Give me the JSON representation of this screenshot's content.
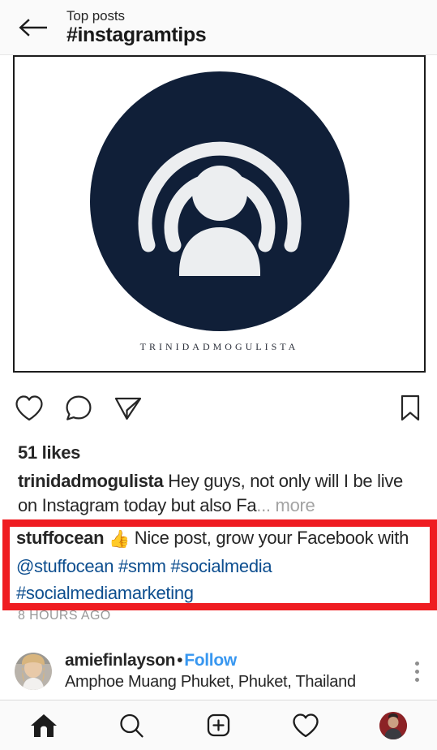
{
  "header": {
    "back_icon": "arrow-left-icon",
    "subtitle": "Top posts",
    "title": "#instagramtips"
  },
  "post": {
    "media": {
      "brand_text": "TRINIDADMOGULISTA",
      "logo_icon": "broadcast-person-icon",
      "logo_bg_color": "#101f38",
      "logo_fg_color": "#eceef0"
    },
    "actions": {
      "like_icon": "heart-icon",
      "comment_icon": "comment-bubble-icon",
      "share_icon": "paper-plane-icon",
      "save_icon": "bookmark-icon"
    },
    "likes": "51 likes",
    "caption": {
      "username": "trinidadmogulista",
      "text": " Hey guys, not only will I be live on Instagram today but also Fa",
      "ellipsis": "...",
      "more_label": " more"
    },
    "highlighted_comment": {
      "username": "stuffocean",
      "emoji": "👍",
      "text_before": " Nice post, grow your Facebook with ",
      "mention": "@stuffocean",
      "hashtag1": "#smm",
      "hashtag2": "#socialmedia",
      "hashtag3": "#socialmediamarketing",
      "highlight_color": "#ef1c21",
      "link_color": "#0d4e8f"
    },
    "timestamp": "8 HOURS AGO"
  },
  "next_post": {
    "avatar": "user-avatar",
    "username": "amiefinlayson",
    "separator": "•",
    "follow_label": "Follow",
    "follow_color": "#3897f0",
    "location": "Amphoe Muang Phuket, Phuket, Thailand",
    "menu_icon": "more-options-icon"
  },
  "bottom_nav": {
    "items": [
      {
        "name": "home",
        "icon": "home-icon",
        "active": true
      },
      {
        "name": "search",
        "icon": "search-icon",
        "active": false
      },
      {
        "name": "create",
        "icon": "plus-square-icon",
        "active": false
      },
      {
        "name": "activity",
        "icon": "heart-icon",
        "active": false
      },
      {
        "name": "profile",
        "icon": "profile-avatar-icon",
        "active": false
      }
    ]
  }
}
